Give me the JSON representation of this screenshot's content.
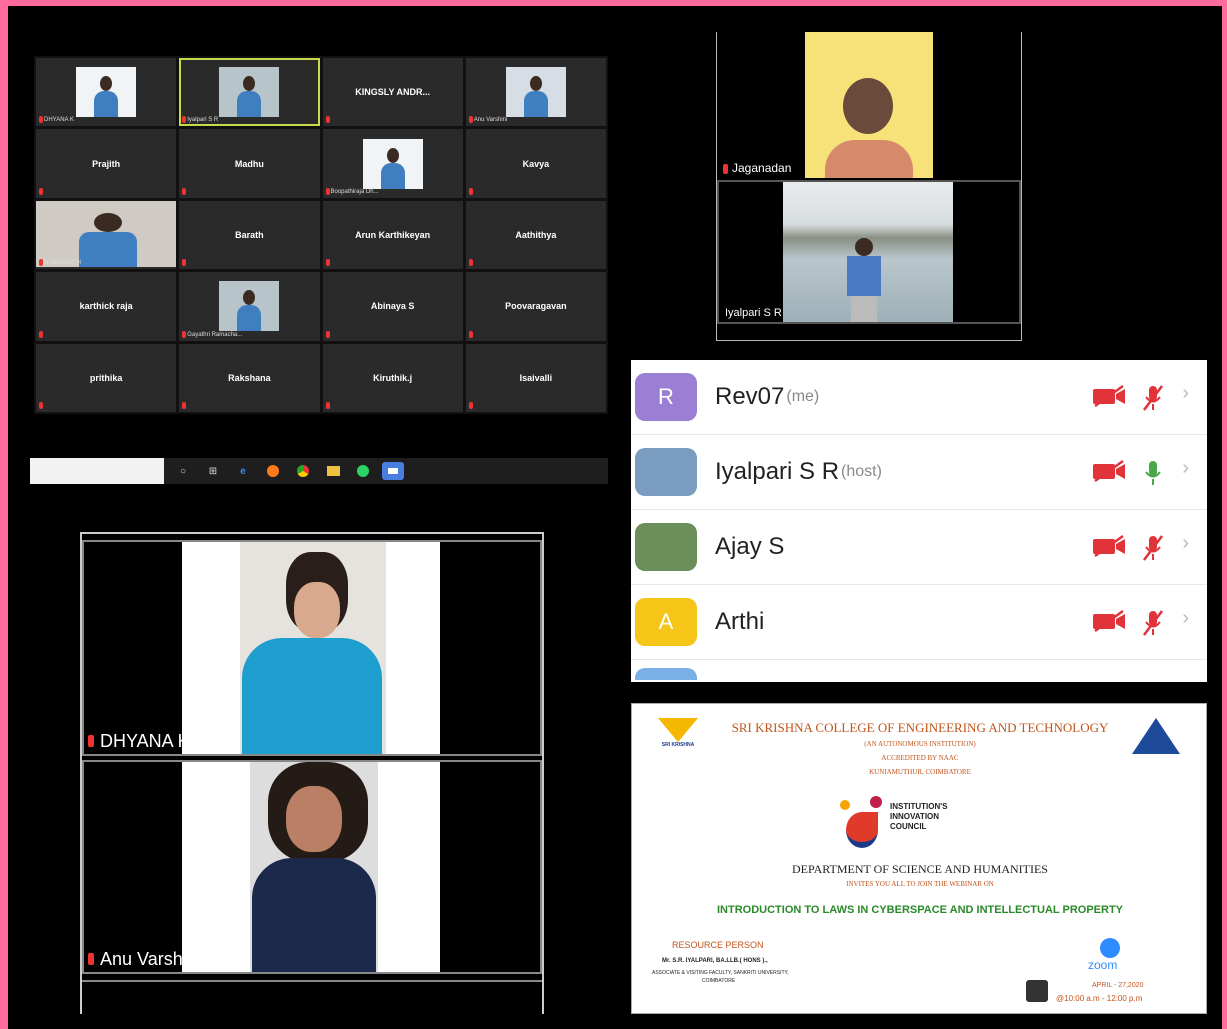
{
  "grid": {
    "tiles": [
      {
        "name": "",
        "label": "DHYANA K",
        "kind": "video"
      },
      {
        "name": "",
        "label": "Iyalpari S R",
        "kind": "video",
        "active": true
      },
      {
        "name": "KINGSLY ANDR...",
        "label": ""
      },
      {
        "name": "",
        "label": "Anu Varshini",
        "kind": "video"
      },
      {
        "name": "Prajith",
        "label": ""
      },
      {
        "name": "Madhu",
        "label": ""
      },
      {
        "name": "",
        "label": "Boopathiraja Dh...",
        "kind": "video"
      },
      {
        "name": "Kavya",
        "label": ""
      },
      {
        "name": "",
        "label": "G NISHANTH",
        "kind": "video-wide"
      },
      {
        "name": "Barath",
        "label": ""
      },
      {
        "name": "Arun Karthikeyan",
        "label": ""
      },
      {
        "name": "Aathithya",
        "label": ""
      },
      {
        "name": "karthick raja",
        "label": ""
      },
      {
        "name": "",
        "label": "Gayathri Ramacha...",
        "kind": "video"
      },
      {
        "name": "Abinaya S",
        "label": ""
      },
      {
        "name": "Poovaragavan",
        "label": ""
      },
      {
        "name": "prithika",
        "label": ""
      },
      {
        "name": "Rakshana",
        "label": ""
      },
      {
        "name": "Kiruthik.j",
        "label": ""
      },
      {
        "name": "Isaivalli",
        "label": ""
      }
    ]
  },
  "taskbar": {
    "icons": [
      "circle-icon",
      "task-view-icon",
      "edge-icon",
      "firefox-icon",
      "chrome-icon",
      "file-explorer-icon",
      "whatsapp-icon",
      "zoom-icon"
    ]
  },
  "right_videos": {
    "top_label": "Jaganadan",
    "bottom_label": "Iyalpari S R"
  },
  "participants": [
    {
      "avatar_letter": "R",
      "avatar_color": "#9b7fd4",
      "name": "Rev07",
      "tag": "(me)",
      "mic": "muted"
    },
    {
      "avatar_letter": "",
      "avatar_color": "#7a9cc0",
      "name": "Iyalpari S R",
      "tag": "(host)",
      "mic": "on"
    },
    {
      "avatar_letter": "",
      "avatar_color": "#6b8f5a",
      "name": "Ajay S",
      "tag": "",
      "mic": "muted"
    },
    {
      "avatar_letter": "A",
      "avatar_color": "#f5c518",
      "name": "Arthi",
      "tag": "",
      "mic": "muted"
    }
  ],
  "bottom_videos": {
    "top_label": "DHYANA K",
    "bottom_label": "Anu Varshini"
  },
  "poster": {
    "college": "SRI KRISHNA COLLEGE OF ENGINEERING AND TECHNOLOGY",
    "line2": "(AN AUTONOMOUS INSTITUTION)",
    "line3": "ACCREDITED BY NAAC",
    "line4": "KUNIAMUTHUR, COIMBATORE",
    "iic1": "INSTITUTION'S",
    "iic2": "INNOVATION",
    "iic3": "COUNCIL",
    "dept": "DEPARTMENT OF SCIENCE AND HUMANITIES",
    "invite": "INVITES YOU ALL TO JOIN THE WEBINAR ON",
    "topic": "INTRODUCTION TO LAWS IN CYBERSPACE AND INTELLECTUAL PROPERTY",
    "resource_heading": "RESOURCE PERSON",
    "resource_name": "Mr. S.R. IYALPARI, BA.LLB.( HONS ).,",
    "resource_desc1": "ASSOCIATE & VISITING FACULTY, SANKRITI UNIVERSITY,",
    "resource_desc2": "COIMBATORE",
    "zoom": "zoom",
    "date": "APRIL - 27,2020",
    "time": "@10:00 a.m - 12:00 p.m"
  }
}
